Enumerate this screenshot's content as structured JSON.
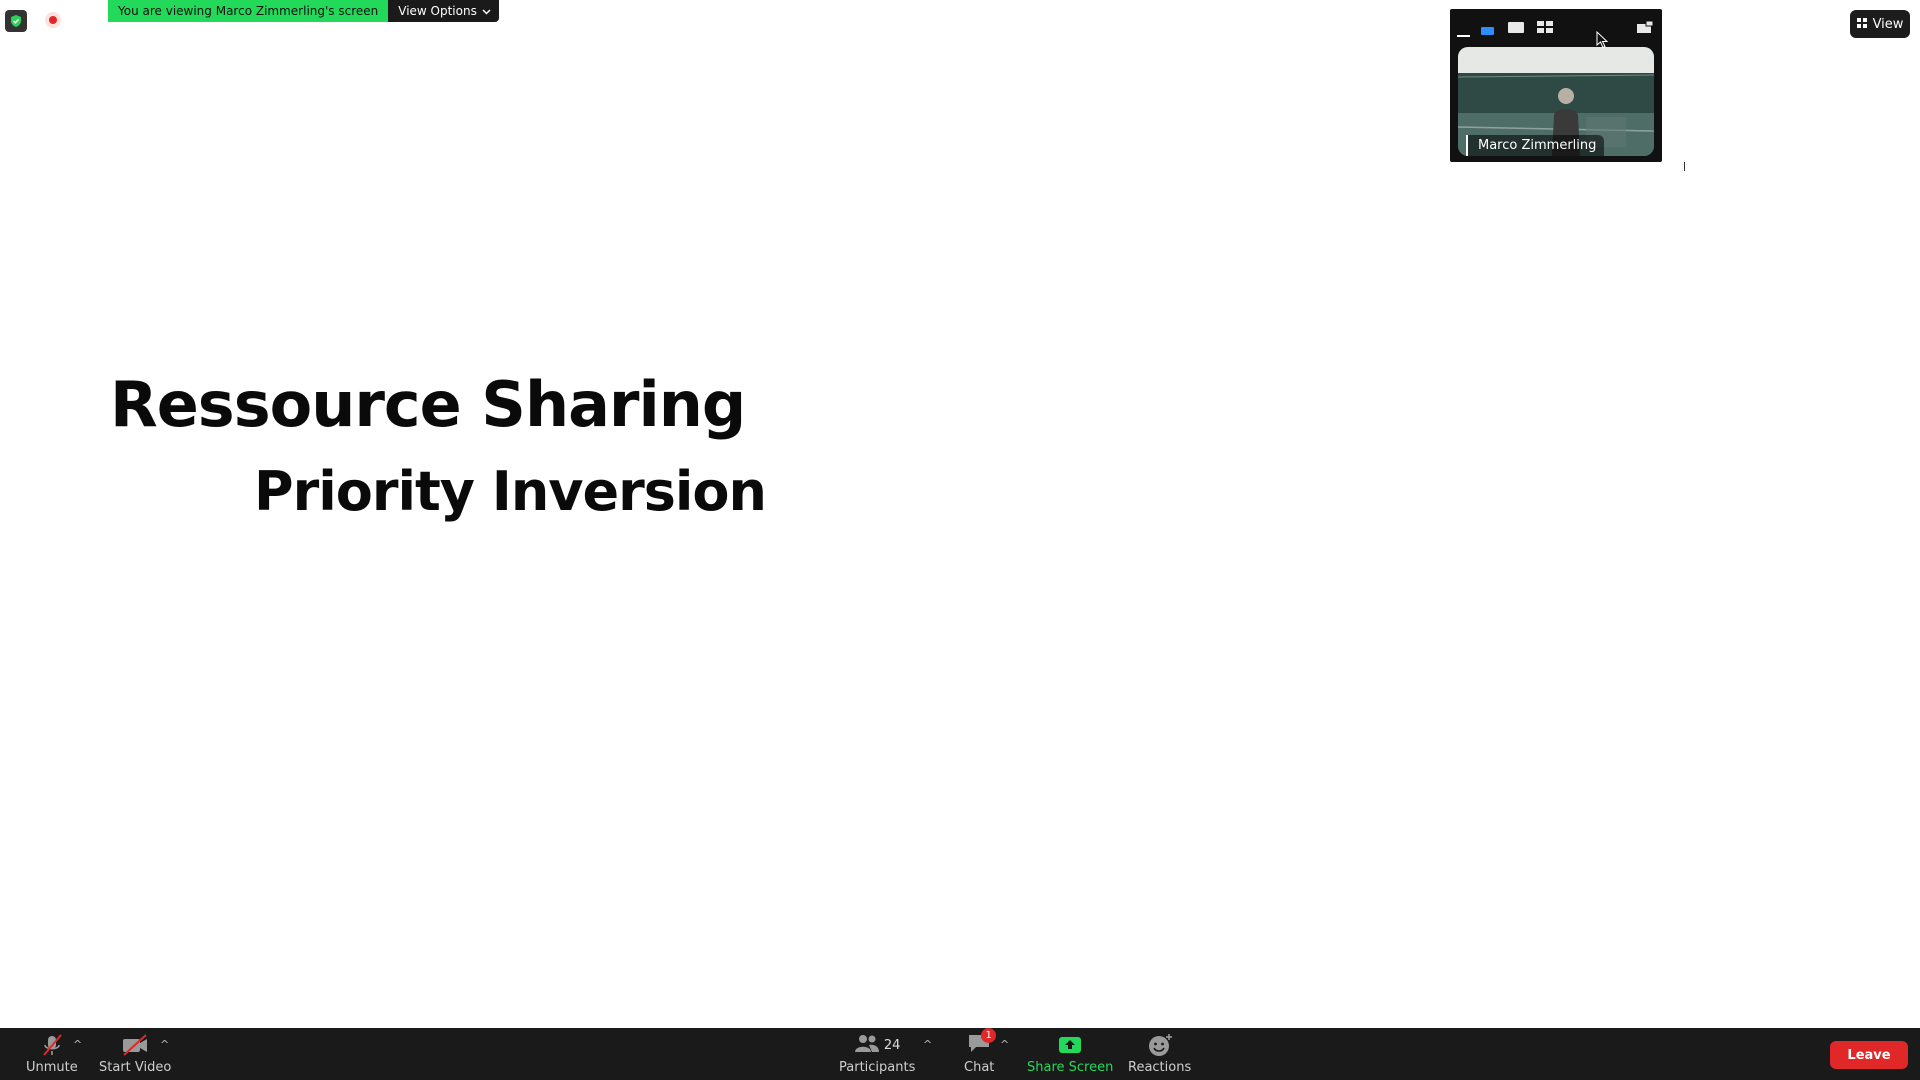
{
  "banner": {
    "viewing_text": "You are viewing Marco Zimmerling's screen",
    "options_label": "View Options"
  },
  "view_button": {
    "label": "View"
  },
  "video_panel": {
    "participant_name": "Marco Zimmerling"
  },
  "slide": {
    "title": "Ressource Sharing",
    "subtitle": "Priority Inversion"
  },
  "toolbar": {
    "unmute_label": "Unmute",
    "start_video_label": "Start Video",
    "participants_label": "Participants",
    "participants_count": "24",
    "chat_label": "Chat",
    "chat_badge": "1",
    "share_label": "Share Screen",
    "reactions_label": "Reactions",
    "leave_label": "Leave"
  },
  "colors": {
    "banner_green": "#23d959",
    "share_green": "#23d959",
    "leave_red": "#e02828",
    "toolbar_bg": "#1a1a1a"
  }
}
